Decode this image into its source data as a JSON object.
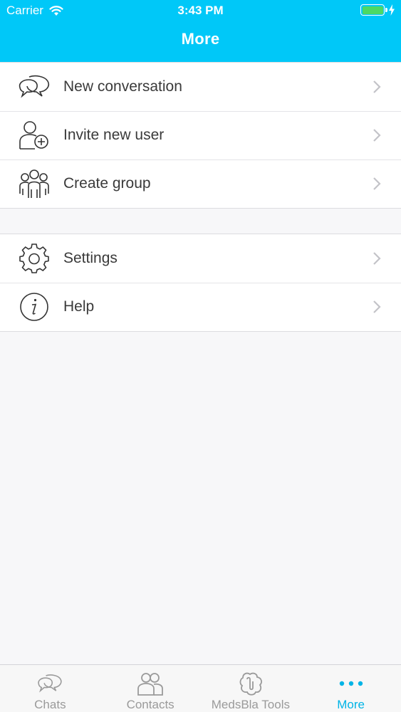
{
  "status_bar": {
    "carrier": "Carrier",
    "time": "3:43 PM"
  },
  "header": {
    "title": "More"
  },
  "menu": {
    "section1": [
      {
        "label": "New conversation",
        "icon": "chat-bubbles-icon"
      },
      {
        "label": "Invite new user",
        "icon": "add-user-icon"
      },
      {
        "label": "Create group",
        "icon": "group-icon"
      }
    ],
    "section2": [
      {
        "label": "Settings",
        "icon": "gear-icon"
      },
      {
        "label": "Help",
        "icon": "info-icon"
      }
    ]
  },
  "tabs": [
    {
      "label": "Chats",
      "icon": "chat-bubbles-icon",
      "active": false
    },
    {
      "label": "Contacts",
      "icon": "contacts-icon",
      "active": false
    },
    {
      "label": "MedsBla Tools",
      "icon": "tools-icon",
      "active": false
    },
    {
      "label": "More",
      "icon": "more-dots-icon",
      "active": true
    }
  ],
  "colors": {
    "header": "#00c8f8",
    "active_tab": "#00b4e6",
    "battery": "#4cd964"
  }
}
